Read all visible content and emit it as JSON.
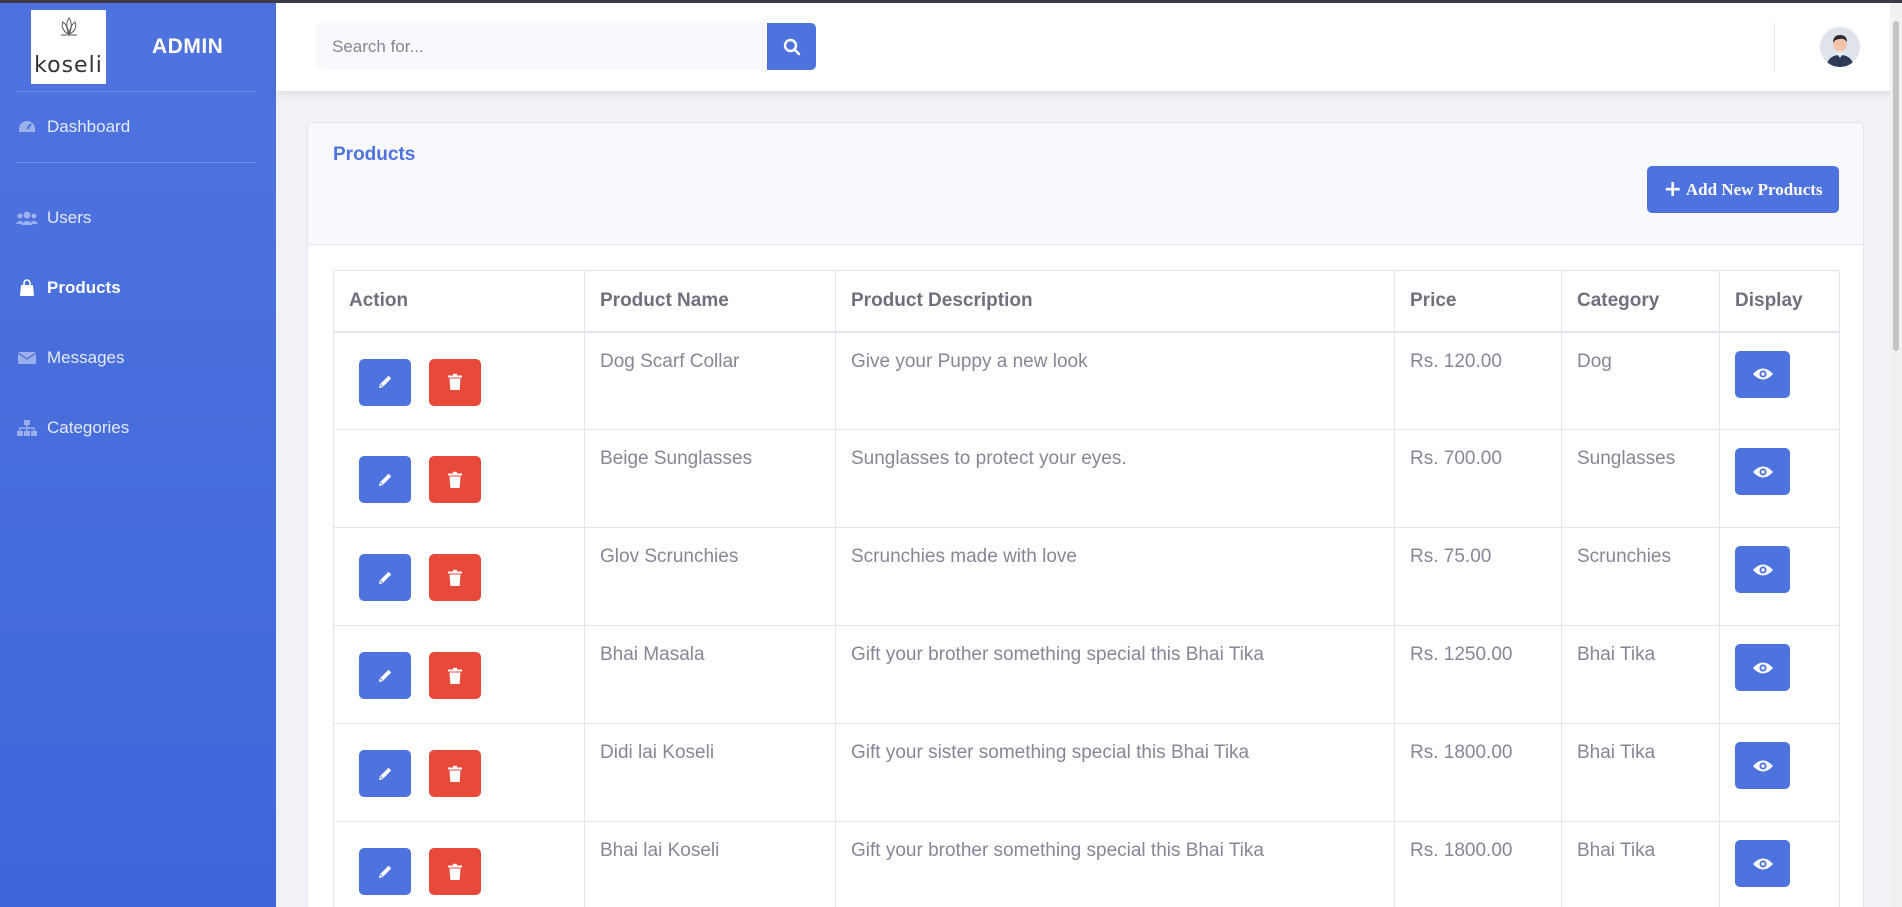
{
  "sidebar": {
    "logo_text": "koseli",
    "brand_title": "ADMIN",
    "items": [
      {
        "label": "Dashboard",
        "icon": "tachometer-icon"
      },
      {
        "label": "Users",
        "icon": "users-icon"
      },
      {
        "label": "Products",
        "icon": "shopping-bag-icon",
        "active": true
      },
      {
        "label": "Messages",
        "icon": "envelope-icon"
      },
      {
        "label": "Categories",
        "icon": "sitemap-icon"
      }
    ]
  },
  "topbar": {
    "search_placeholder": "Search for..."
  },
  "card": {
    "title": "Products",
    "add_button_label": "Add New Products"
  },
  "table": {
    "columns": [
      "Action",
      "Product Name",
      "Product Description",
      "Price",
      "Category",
      "Display"
    ],
    "rows": [
      {
        "name": "Dog Scarf Collar",
        "description": "Give your Puppy a new look",
        "price": "Rs. 120.00",
        "category": "Dog"
      },
      {
        "name": "Beige Sunglasses",
        "description": "Sunglasses to protect your eyes.",
        "price": "Rs. 700.00",
        "category": "Sunglasses"
      },
      {
        "name": "Glov Scrunchies",
        "description": "Scrunchies made with love",
        "price": "Rs. 75.00",
        "category": "Scrunchies"
      },
      {
        "name": "Bhai Masala",
        "description": "Gift your brother something special this Bhai Tika",
        "price": "Rs. 1250.00",
        "category": "Bhai Tika"
      },
      {
        "name": "Didi lai Koseli",
        "description": "Gift your sister something special this Bhai Tika",
        "price": "Rs. 1800.00",
        "category": "Bhai Tika"
      },
      {
        "name": "Bhai lai Koseli",
        "description": "Gift your brother something special this Bhai Tika",
        "price": "Rs. 1800.00",
        "category": "Bhai Tika"
      }
    ]
  },
  "colors": {
    "primary": "#4e73df",
    "danger": "#e74a3b",
    "text": "#858796"
  }
}
